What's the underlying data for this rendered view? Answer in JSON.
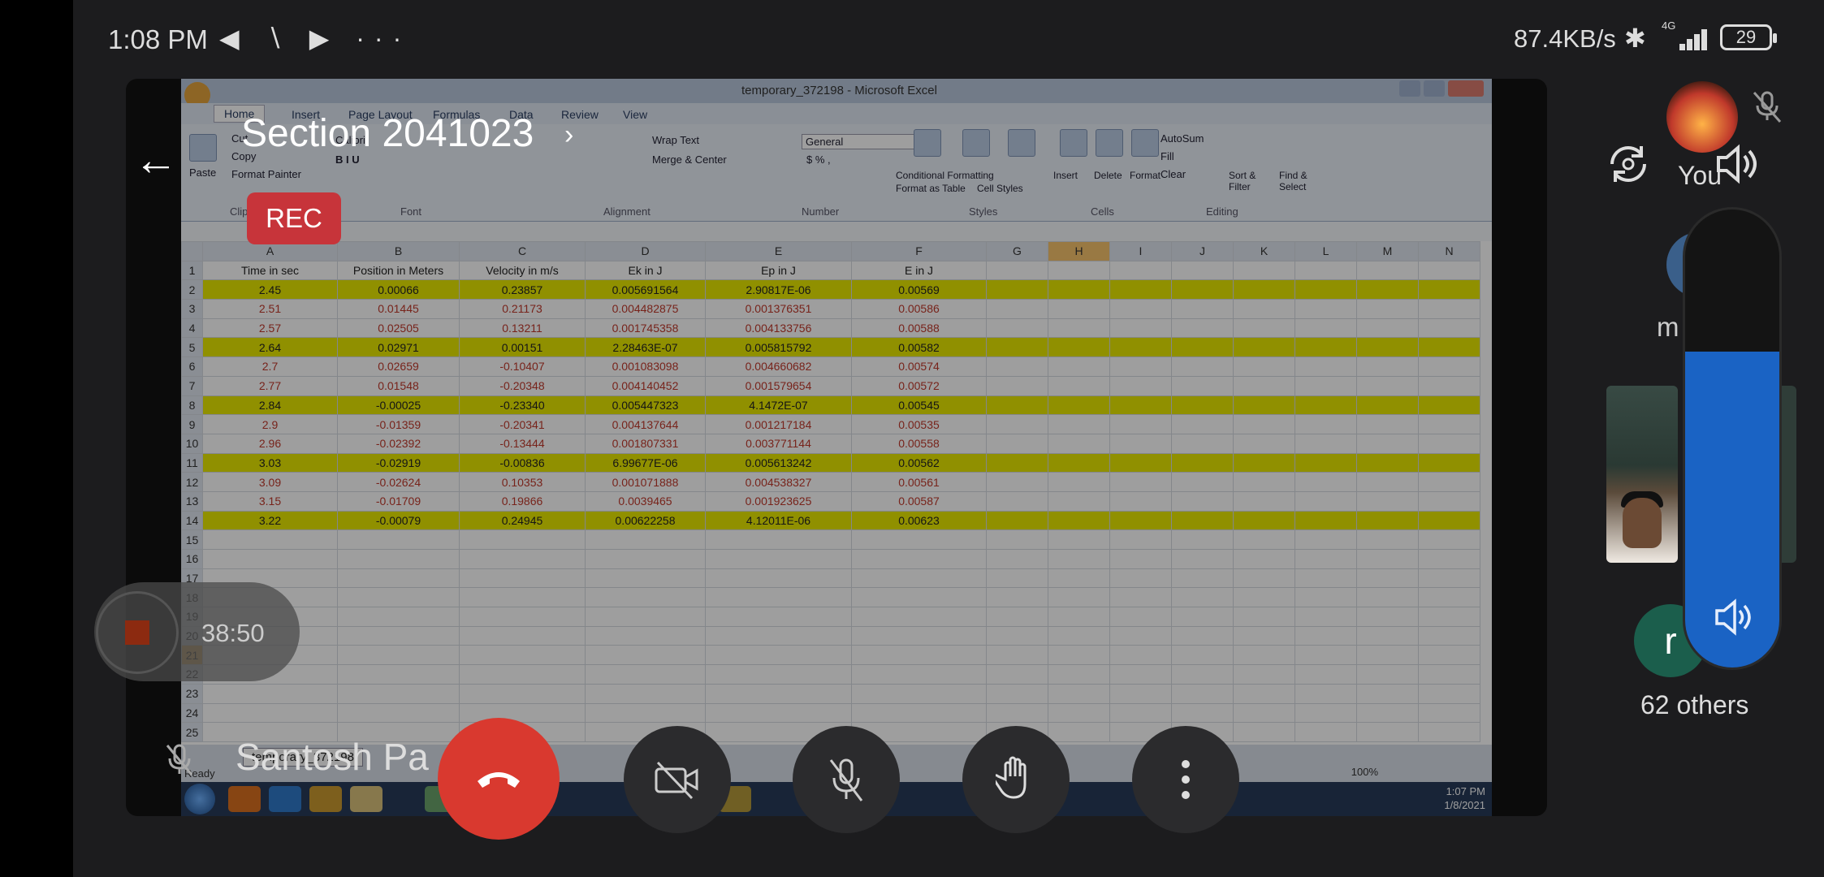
{
  "status_bar": {
    "time": "1:08 PM",
    "left_icons": "◀ ∖ ▶ ···",
    "network_speed": "87.4KB/s",
    "bluetooth": "✱",
    "network_type": "4G",
    "battery": "29"
  },
  "meeting": {
    "title": "Section 2041023",
    "rec_badge": "REC",
    "recording_timer": "38:50",
    "presenter_name": "Santosh Pa",
    "you_label": "You",
    "participant_initial_m": "m",
    "participant_initial_r": "r",
    "others_count": "62 others",
    "volume_level_pct": 69,
    "colors": {
      "end_call": "#d9392f",
      "rec": "#c7343a",
      "volume": "#1a63c4",
      "background": "#1c1c1e"
    }
  },
  "excel": {
    "window_title": "temporary_372198 - Microsoft Excel",
    "tabs": [
      "Home",
      "Insert",
      "Page Layout",
      "Formulas",
      "Data",
      "Review",
      "View"
    ],
    "ribbon": {
      "clipboard": [
        "Paste",
        "Cut",
        "Copy",
        "Format Painter"
      ],
      "font_name": "Calibri",
      "wrap_text": "Wrap Text",
      "merge_center": "Merge & Center",
      "number_format": "General",
      "number_symbols": "$ % ,",
      "styles": [
        "Conditional Formatting",
        "Format as Table",
        "Cell Styles"
      ],
      "cells": [
        "Insert",
        "Delete",
        "Format"
      ],
      "editing": [
        "AutoSum",
        "Fill",
        "Clear",
        "Sort & Filter",
        "Find & Select"
      ],
      "groups": [
        "Clipboard",
        "Font",
        "Alignment",
        "Number",
        "Styles",
        "Cells",
        "Editing"
      ]
    },
    "columns": [
      "A",
      "B",
      "C",
      "D",
      "E",
      "F",
      "G",
      "H",
      "I",
      "J",
      "K",
      "L",
      "M",
      "N"
    ],
    "header_row": [
      "Time in sec",
      "Position in Meters",
      "Velocity in m/s",
      "Ek in J",
      "Ep in J",
      "E in J"
    ],
    "rows": [
      [
        "2.45",
        "0.00066",
        "0.23857",
        "0.005691564",
        "2.90817E-06",
        "0.00569"
      ],
      [
        "2.51",
        "0.01445",
        "0.21173",
        "0.004482875",
        "0.001376351",
        "0.00586"
      ],
      [
        "2.57",
        "0.02505",
        "0.13211",
        "0.001745358",
        "0.004133756",
        "0.00588"
      ],
      [
        "2.64",
        "0.02971",
        "0.00151",
        "2.28463E-07",
        "0.005815792",
        "0.00582"
      ],
      [
        "2.7",
        "0.02659",
        "-0.10407",
        "0.001083098",
        "0.004660682",
        "0.00574"
      ],
      [
        "2.77",
        "0.01548",
        "-0.20348",
        "0.004140452",
        "0.001579654",
        "0.00572"
      ],
      [
        "2.84",
        "-0.00025",
        "-0.23340",
        "0.005447323",
        "4.1472E-07",
        "0.00545"
      ],
      [
        "2.9",
        "-0.01359",
        "-0.20341",
        "0.004137644",
        "0.001217184",
        "0.00535"
      ],
      [
        "2.96",
        "-0.02392",
        "-0.13444",
        "0.001807331",
        "0.003771144",
        "0.00558"
      ],
      [
        "3.03",
        "-0.02919",
        "-0.00836",
        "6.99677E-06",
        "0.005613242",
        "0.00562"
      ],
      [
        "3.09",
        "-0.02624",
        "0.10353",
        "0.001071888",
        "0.004538327",
        "0.00561"
      ],
      [
        "3.15",
        "-0.01709",
        "0.19866",
        "0.0039465",
        "0.001923625",
        "0.00587"
      ],
      [
        "3.22",
        "-0.00079",
        "0.24945",
        "0.00622258",
        "4.12011E-06",
        "0.00623"
      ]
    ],
    "highlighted_rows": [
      2,
      5,
      8,
      11,
      14
    ],
    "sheet_tab": "temporary_372198",
    "status": "Ready",
    "zoom": "100%",
    "clock_time": "1:07 PM",
    "clock_date": "1/8/2021"
  }
}
